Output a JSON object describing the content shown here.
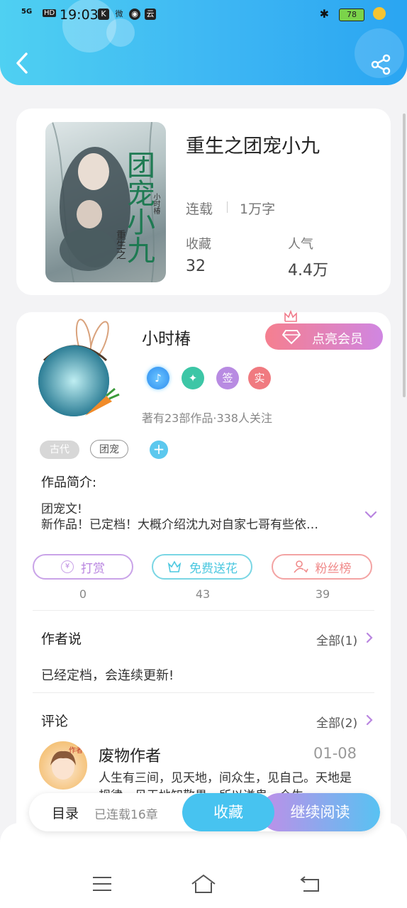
{
  "status_bar": {
    "network": "5G",
    "hd": "HD",
    "time": "19:03",
    "app_icons": [
      "K",
      "微",
      "◉",
      "云"
    ],
    "battery": "78"
  },
  "book": {
    "title": "重生之团宠小九",
    "cover_text": "团宠小九",
    "cover_sub": "重生之",
    "cover_author": "小时椿",
    "status": "连载",
    "word_count": "1万字",
    "favorites_label": "收藏",
    "favorites_value": "32",
    "popularity_label": "人气",
    "popularity_value": "4.4万"
  },
  "author": {
    "name": "小时椿",
    "vip_label": "点亮会员",
    "badges": [
      "签",
      "实"
    ],
    "stats": "著有23部作品·338人关注"
  },
  "tags": [
    "古代",
    "团宠"
  ],
  "intro": {
    "heading": "作品简介:",
    "line1": "团宠文!",
    "line2": "新作品！已定档！大概介绍沈九对自家七哥有些依…"
  },
  "actions": [
    {
      "label": "打赏",
      "count": "0",
      "icon": "yen-icon"
    },
    {
      "label": "免费送花",
      "count": "43",
      "icon": "flower-icon"
    },
    {
      "label": "粉丝榜",
      "count": "39",
      "icon": "fan-icon"
    }
  ],
  "author_says": {
    "heading": "作者说",
    "more": "全部(1)",
    "text": "已经定档，会连续更新!"
  },
  "comments": {
    "heading": "评论",
    "more": "全部(2)",
    "items": [
      {
        "name": "废物作者",
        "date": "01-08",
        "avatar_tag": "作者",
        "text": "人生有三间，见天地，间众生，见自己。天地是规律，见天地知敬畏，所以谦卑，众生"
      }
    ]
  },
  "bottom_bar": {
    "toc": "目录",
    "chapters": "已连载16章",
    "favorite": "收藏",
    "continue": "继续阅读"
  },
  "colors": {
    "header_start": "#4fd0f2",
    "header_end": "#2aa5f2",
    "accent_purple": "#b985e0",
    "accent_cyan": "#4cc8e0",
    "accent_red": "#f08a8a"
  }
}
